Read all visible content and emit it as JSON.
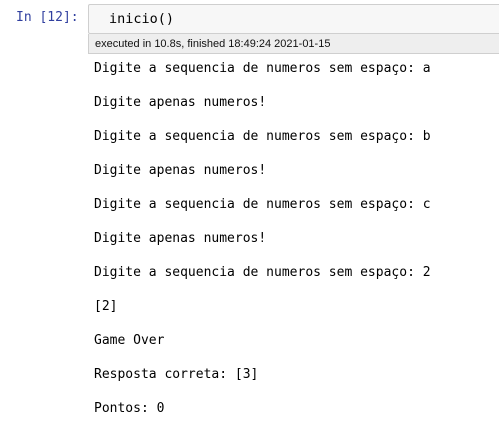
{
  "cell": {
    "prompt": "In [12]:",
    "code": "inicio()",
    "execution_info": "executed in 10.8s, finished 18:49:24 2021-01-15"
  },
  "output": {
    "lines": [
      "Digite a sequencia de numeros sem espaço: a",
      "Digite apenas numeros!",
      "Digite a sequencia de numeros sem espaço: b",
      "Digite apenas numeros!",
      "Digite a sequencia de numeros sem espaço: c",
      "Digite apenas numeros!",
      "Digite a sequencia de numeros sem espaço: 2",
      "[2]",
      "Game Over",
      "Resposta correta: [3]",
      "Pontos: 0"
    ]
  },
  "colors": {
    "prompt": "#303f9f",
    "input_background": "#f7f7f7",
    "timing_background": "#eeeeee",
    "border": "#cfcfcf"
  }
}
